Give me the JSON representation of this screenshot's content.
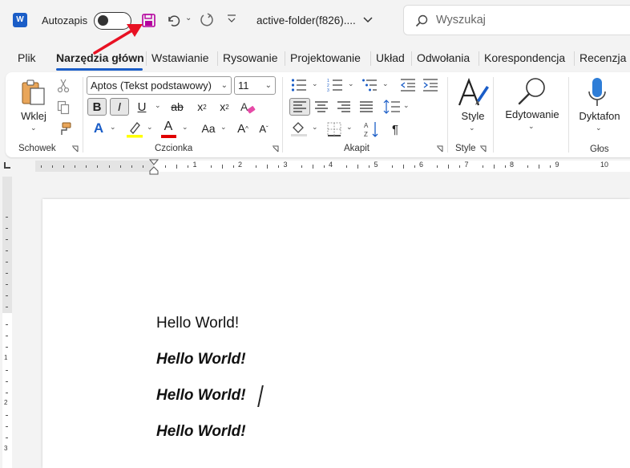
{
  "titlebar": {
    "app_logo_letter": "W",
    "autosave_label": "Autozapis",
    "autosave_on": false,
    "document_title": "active-folder(f826)....",
    "search_placeholder": "Wyszukaj"
  },
  "tabs": [
    {
      "label": "Plik",
      "active": false
    },
    {
      "label": "Narzędzia główn",
      "active": true
    },
    {
      "label": "Wstawianie",
      "active": false
    },
    {
      "label": "Rysowanie",
      "active": false
    },
    {
      "label": "Projektowanie",
      "active": false
    },
    {
      "label": "Układ",
      "active": false
    },
    {
      "label": "Odwołania",
      "active": false
    },
    {
      "label": "Korespondencja",
      "active": false
    },
    {
      "label": "Recenzja",
      "active": false
    }
  ],
  "ribbon": {
    "clipboard": {
      "label": "Schowek",
      "paste_label": "Wklej"
    },
    "font": {
      "label": "Czcionka",
      "font_name": "Aptos (Tekst podstawowy)",
      "font_size": "11",
      "bold": "B",
      "italic": "I",
      "underline": "U",
      "strike": "ab",
      "subscript": "x",
      "subscript_mark": "2",
      "superscript": "x",
      "superscript_mark": "2",
      "grow": "A",
      "shrink": "A",
      "change_case": "Aa",
      "text_effects": "A",
      "font_color": "A"
    },
    "paragraph": {
      "label": "Akapit",
      "pilcrow": "¶"
    },
    "styles": {
      "label": "Style",
      "button_label": "Style"
    },
    "editing": {
      "button_label": "Edytowanie"
    },
    "voice": {
      "label": "Głos",
      "button_label": "Dyktafon"
    }
  },
  "ruler": {
    "numbers": [
      "1",
      "2",
      "3",
      "4",
      "5",
      "6",
      "7",
      "8",
      "9",
      "10"
    ],
    "vertical_numbers": [
      "1",
      "2",
      "3"
    ]
  },
  "document": {
    "lines": [
      {
        "text": "Hello World!",
        "style": "regular"
      },
      {
        "text": "Hello World!",
        "style": "bold-italic"
      },
      {
        "text": "Hello World!",
        "style": "bold-italic"
      },
      {
        "text": "Hello World!",
        "style": "bold-italic"
      }
    ]
  },
  "colors": {
    "accent": "#1a5dc7",
    "save_icon": "#b4009e",
    "annotation_arrow": "#e81123",
    "highlight": "#ffff00",
    "font_color_bar": "#e00000"
  }
}
